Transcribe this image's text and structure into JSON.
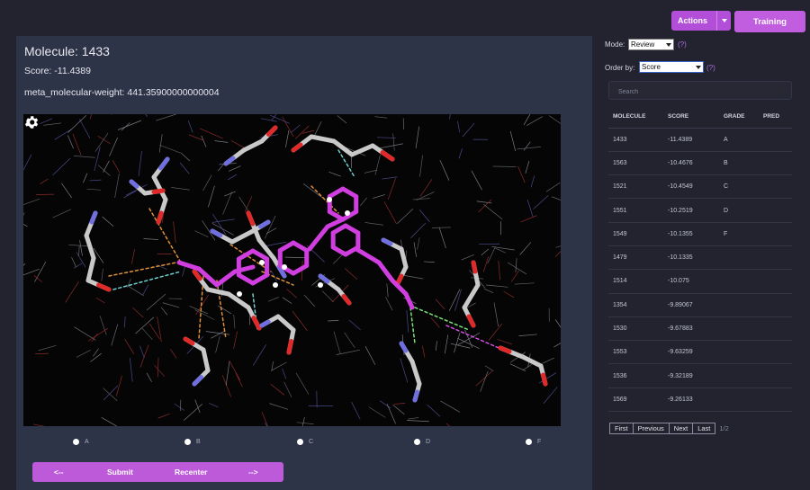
{
  "topbar": {
    "actions_label": "Actions",
    "training_label": "Training"
  },
  "molecule": {
    "title": "Molecule: 1433",
    "score": "Score: -11.4389",
    "weight": "meta_molecular-weight: 441.35900000000004"
  },
  "grades": [
    {
      "label": "A"
    },
    {
      "label": "B"
    },
    {
      "label": "C"
    },
    {
      "label": "D"
    },
    {
      "label": "F"
    }
  ],
  "nav": {
    "prev": "<--",
    "submit": "Submit",
    "recenter": "Recenter",
    "next": "-->"
  },
  "sidebar": {
    "mode_label": "Mode:",
    "mode_value": "Review",
    "order_label": "Order by:",
    "order_value": "Score",
    "help": "(?)",
    "search_placeholder": "Search",
    "columns": [
      "MOLECULE",
      "SCORE",
      "GRADE",
      "PRED"
    ],
    "rows": [
      {
        "molecule": "1433",
        "score": "-11.4389",
        "grade": "A",
        "pred": ""
      },
      {
        "molecule": "1563",
        "score": "-10.4676",
        "grade": "B",
        "pred": ""
      },
      {
        "molecule": "1521",
        "score": "-10.4549",
        "grade": "C",
        "pred": ""
      },
      {
        "molecule": "1551",
        "score": "-10.2519",
        "grade": "D",
        "pred": ""
      },
      {
        "molecule": "1549",
        "score": "-10.1355",
        "grade": "F",
        "pred": ""
      },
      {
        "molecule": "1479",
        "score": "-10.1335",
        "grade": "",
        "pred": ""
      },
      {
        "molecule": "1514",
        "score": "-10.075",
        "grade": "",
        "pred": ""
      },
      {
        "molecule": "1354",
        "score": "-9.89067",
        "grade": "",
        "pred": ""
      },
      {
        "molecule": "1530",
        "score": "-9.67883",
        "grade": "",
        "pred": ""
      },
      {
        "molecule": "1553",
        "score": "-9.63259",
        "grade": "",
        "pred": ""
      },
      {
        "molecule": "1536",
        "score": "-9.32189",
        "grade": "",
        "pred": ""
      },
      {
        "molecule": "1569",
        "score": "-9.26133",
        "grade": "",
        "pred": ""
      }
    ],
    "pager": {
      "first": "First",
      "previous": "Previous",
      "next": "Next",
      "last": "Last",
      "info": "1/2"
    }
  },
  "colors": {
    "accent": "#bd5ada",
    "ligand": "#d13ee0",
    "carbon": "#c9c9c9",
    "oxygen": "#e02a2a",
    "nitrogen": "#6f6fe0"
  },
  "icons": {
    "gear": "settings-gear-icon"
  }
}
